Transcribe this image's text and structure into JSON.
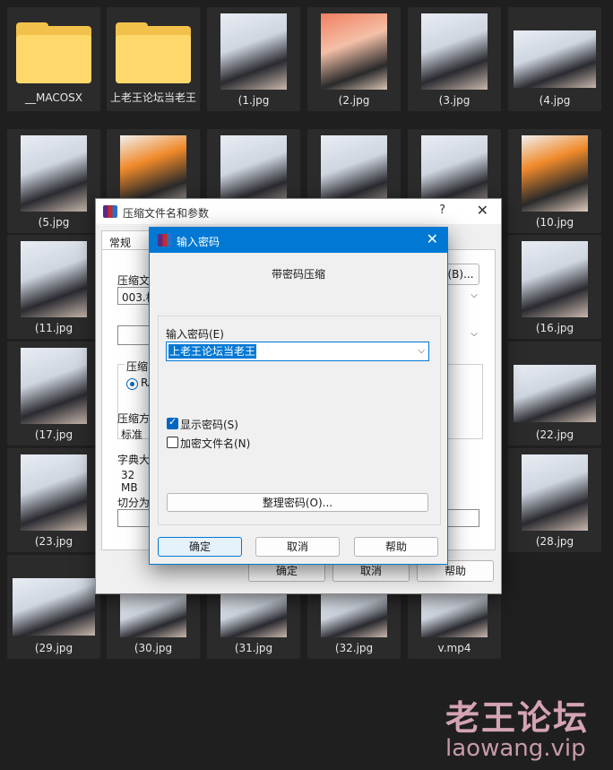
{
  "files": [
    {
      "name": "__MACOSX",
      "kind": "folder"
    },
    {
      "name": "上老王论坛当老王",
      "kind": "folder"
    },
    {
      "name": "(1.jpg",
      "kind": "image"
    },
    {
      "name": "(2.jpg",
      "kind": "image"
    },
    {
      "name": "(3.jpg",
      "kind": "image"
    },
    {
      "name": "(4.jpg",
      "kind": "image"
    },
    {
      "name": "(5.jpg",
      "kind": "image"
    },
    {
      "name": "(10.jpg",
      "kind": "image"
    },
    {
      "name": "(11.jpg",
      "kind": "image"
    },
    {
      "name": "(16.jpg",
      "kind": "image"
    },
    {
      "name": "(17.jpg",
      "kind": "image"
    },
    {
      "name": "(22.jpg",
      "kind": "image"
    },
    {
      "name": "(23.jpg",
      "kind": "image"
    },
    {
      "name": "(28.jpg",
      "kind": "image"
    },
    {
      "name": "(29.jpg",
      "kind": "image"
    },
    {
      "name": "(30.jpg",
      "kind": "image"
    },
    {
      "name": "(31.jpg",
      "kind": "image"
    },
    {
      "name": "(32.jpg",
      "kind": "image"
    },
    {
      "name": "v.mp4",
      "kind": "video"
    }
  ],
  "archive_dialog": {
    "title": "压缩文件名和参数",
    "help_glyph": "?",
    "close_glyph": "✕",
    "tab_general": "常规",
    "archive_name_label": "压缩文",
    "archive_name_value": "003.杭",
    "browse_button": "(B)...",
    "format_group_label": "压缩",
    "format_radio_label": "RA",
    "method_label": "压缩方",
    "method_value": "标准",
    "dict_label": "字典大",
    "dict_value": "32 MB",
    "split_label": "切分为",
    "ok": "确定",
    "cancel": "取消",
    "help": "帮助"
  },
  "password_dialog": {
    "title": "输入密码",
    "close_glyph": "✕",
    "subtitle": "带密码压缩",
    "password_label": "输入密码(E)",
    "password_value": "上老王论坛当老王",
    "show_password_label": "显示密码(S)",
    "show_password_checked": true,
    "encrypt_filenames_label": "加密文件名(N)",
    "encrypt_filenames_checked": false,
    "organize_button": "整理密码(O)...",
    "ok": "确定",
    "cancel": "取消",
    "help": "帮助"
  },
  "watermark": {
    "cn": "老王论坛",
    "en": "laowang.vip"
  }
}
